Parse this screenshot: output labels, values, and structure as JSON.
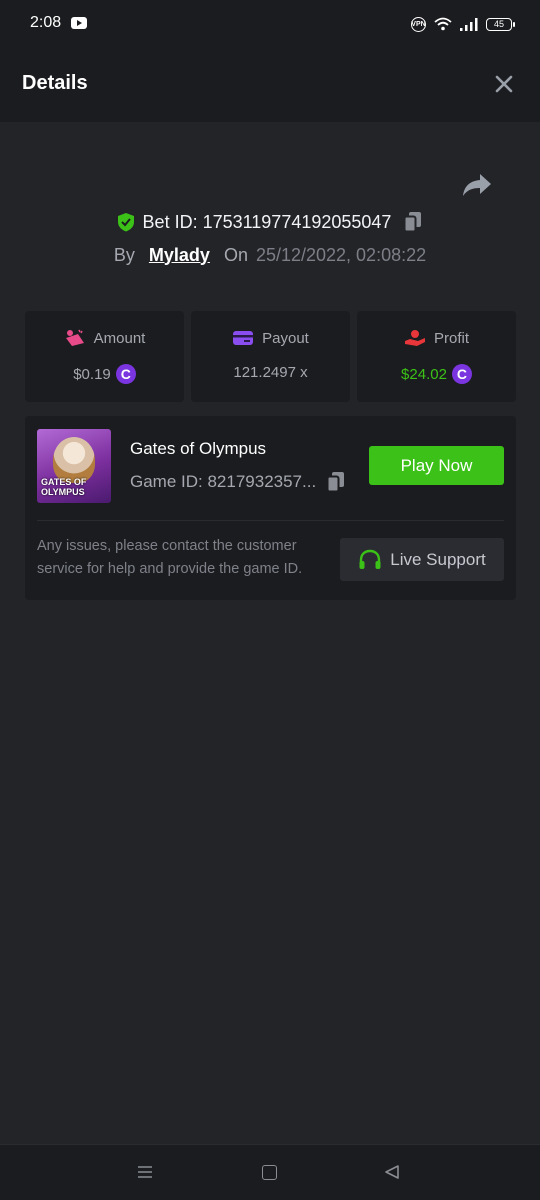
{
  "status_bar": {
    "time": "2:08",
    "vpn": "VPN",
    "battery": "45"
  },
  "header": {
    "title": "Details"
  },
  "bet": {
    "id_label": "Bet ID: 1753119774192055047",
    "by_label": "By",
    "user": "Mylady",
    "on_label": "On",
    "date": "25/12/2022, 02:08:22"
  },
  "stats": {
    "amount": {
      "label": "Amount",
      "value": "$0.19"
    },
    "payout": {
      "label": "Payout",
      "value": "121.2497 x"
    },
    "profit": {
      "label": "Profit",
      "value": "$24.02"
    }
  },
  "game": {
    "thumbnail_text": "GATES OF OLYMPUS",
    "name": "Gates of Olympus",
    "id_label": "Game ID: 8217932357...",
    "play_label": "Play Now",
    "help_text": "Any issues, please contact the customer service for help and provide the game ID.",
    "support_label": "Live Support"
  },
  "colors": {
    "accent_green": "#3bc117",
    "profit_green": "#3bc117",
    "coin_purple": "#7a35e0",
    "card_bg": "#1b1c1f",
    "page_bg": "#232428"
  },
  "icons": {
    "bet_badge": "shield-check-icon",
    "copy": "copy-icon",
    "share": "share-icon",
    "amount": "bet-chips-icon",
    "payout": "card-icon",
    "profit": "hand-money-icon",
    "coin": "coin-icon",
    "support": "headphones-icon"
  }
}
